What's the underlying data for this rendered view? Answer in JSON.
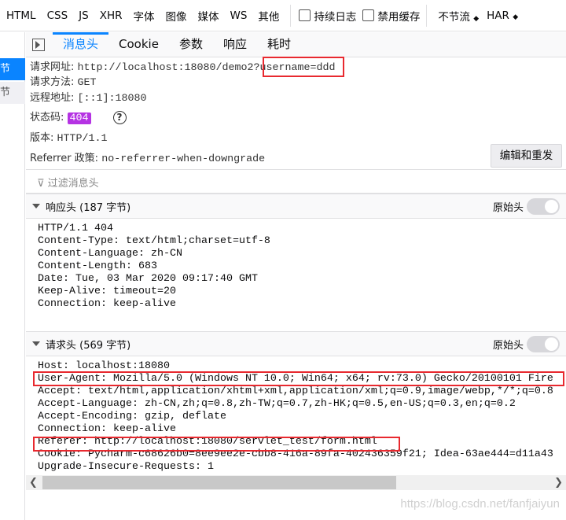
{
  "toolbar": {
    "filters": [
      "HTML",
      "CSS",
      "JS",
      "XHR",
      "字体",
      "图像",
      "媒体",
      "WS",
      "其他"
    ],
    "persist_log": "持续日志",
    "disable_cache": "禁用缓存",
    "throttle": "不节流",
    "har": "HAR"
  },
  "sidebar": {
    "item1": "节",
    "item2": "节"
  },
  "tabs": [
    "消息头",
    "Cookie",
    "参数",
    "响应",
    "耗时"
  ],
  "summary": {
    "url_label": "请求网址:",
    "url_prefix": "http://localhost:18080/demo2?",
    "url_query": "username=ddd",
    "method_label": "请求方法:",
    "method": "GET",
    "remote_label": "远程地址:",
    "remote": "[::1]:18080",
    "status_label": "状态码:",
    "status": "404",
    "version_label": "版本:",
    "version": "HTTP/1.1",
    "referrer_label": "Referrer 政策:",
    "referrer": "no-referrer-when-downgrade",
    "resend_button": "编辑和重发"
  },
  "filter_placeholder": "过滤消息头",
  "response_headers": {
    "title": "响应头 (187 字节)",
    "raw": "原始头",
    "lines": [
      "HTTP/1.1 404",
      "Content-Type: text/html;charset=utf-8",
      "Content-Language: zh-CN",
      "Content-Length: 683",
      "Date: Tue, 03 Mar 2020 09:17:40 GMT",
      "Keep-Alive: timeout=20",
      "Connection: keep-alive"
    ]
  },
  "request_headers": {
    "title": "请求头 (569 字节)",
    "raw": "原始头",
    "lines": [
      "Host: localhost:18080",
      "User-Agent: Mozilla/5.0 (Windows NT 10.0; Win64; x64; rv:73.0) Gecko/20100101 Fire",
      "Accept: text/html,application/xhtml+xml,application/xml;q=0.9,image/webp,*/*;q=0.8",
      "Accept-Language: zh-CN,zh;q=0.8,zh-TW;q=0.7,zh-HK;q=0.5,en-US;q=0.3,en;q=0.2",
      "Accept-Encoding: gzip, deflate",
      "Connection: keep-alive",
      "Referer: http://localhost:18080/servlet_test/form.html",
      "Cookie: Pycharm-c68626b0=8ee9ee2e-cbb8-416a-89fa-402436359f21; Idea-63ae444=d11a43",
      "Upgrade-Insecure-Requests: 1"
    ]
  },
  "watermark": "https://blog.csdn.net/fanfjaiyun",
  "colors": {
    "accent": "#0a84ff",
    "status_badge": "#b533e3",
    "highlight": "#e8292f"
  }
}
